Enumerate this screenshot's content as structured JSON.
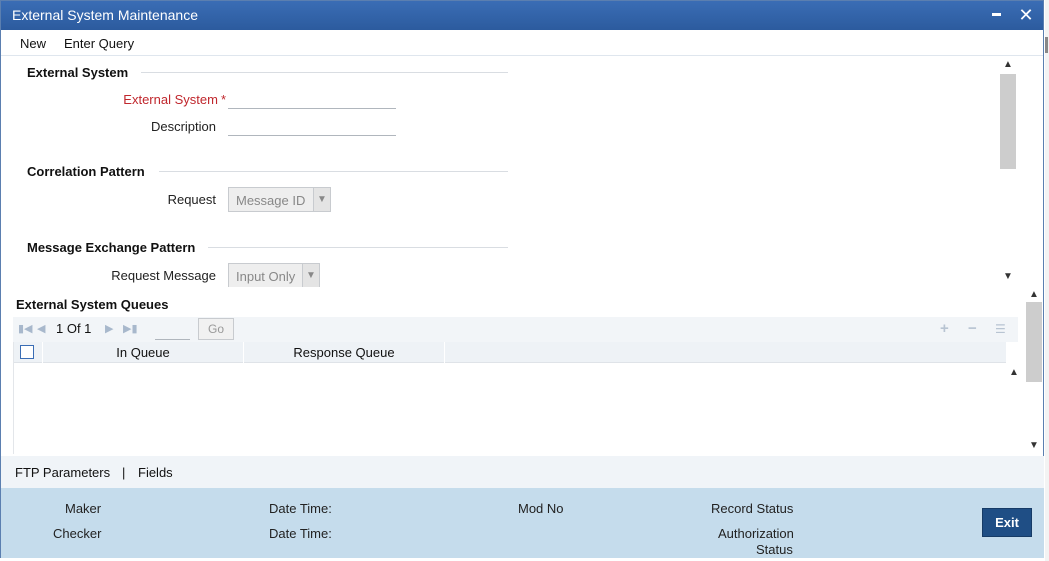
{
  "window": {
    "title": "External System Maintenance",
    "minimize_label": "",
    "close_label": "✕"
  },
  "menu": {
    "new_label": "New",
    "enter_query_label": "Enter Query"
  },
  "external_system": {
    "section_title": "External System",
    "external_system_label": "External System",
    "required_mark": "*",
    "external_system_value": "",
    "description_label": "Description",
    "description_value": ""
  },
  "correlation_pattern": {
    "section_title": "Correlation Pattern",
    "request_label": "Request",
    "request_value": "Message ID"
  },
  "message_exchange_pattern": {
    "section_title": "Message Exchange Pattern",
    "request_message_label": "Request Message",
    "request_message_value": "Input Only"
  },
  "queues": {
    "section_title": "External System Queues",
    "pagination_text": "1 Of 1",
    "go_label": "Go",
    "columns": [
      "In Queue",
      "Response Queue"
    ],
    "rows": []
  },
  "tabs": {
    "ftp_parameters": "FTP Parameters",
    "separator": "|",
    "fields": "Fields"
  },
  "footer": {
    "maker_label": "Maker",
    "checker_label": "Checker",
    "date_time_label_1": "Date Time:",
    "date_time_label_2": "Date Time:",
    "mod_no_label": "Mod No",
    "record_status_label": "Record Status",
    "authorization_status_line1": "Authorization",
    "authorization_status_line2": "Status",
    "exit_label": "Exit"
  },
  "colors": {
    "titlebar": "#2c5b9e",
    "required": "#c0272d",
    "footer_bg": "#c5dcec",
    "exit_button": "#1f4e85"
  }
}
